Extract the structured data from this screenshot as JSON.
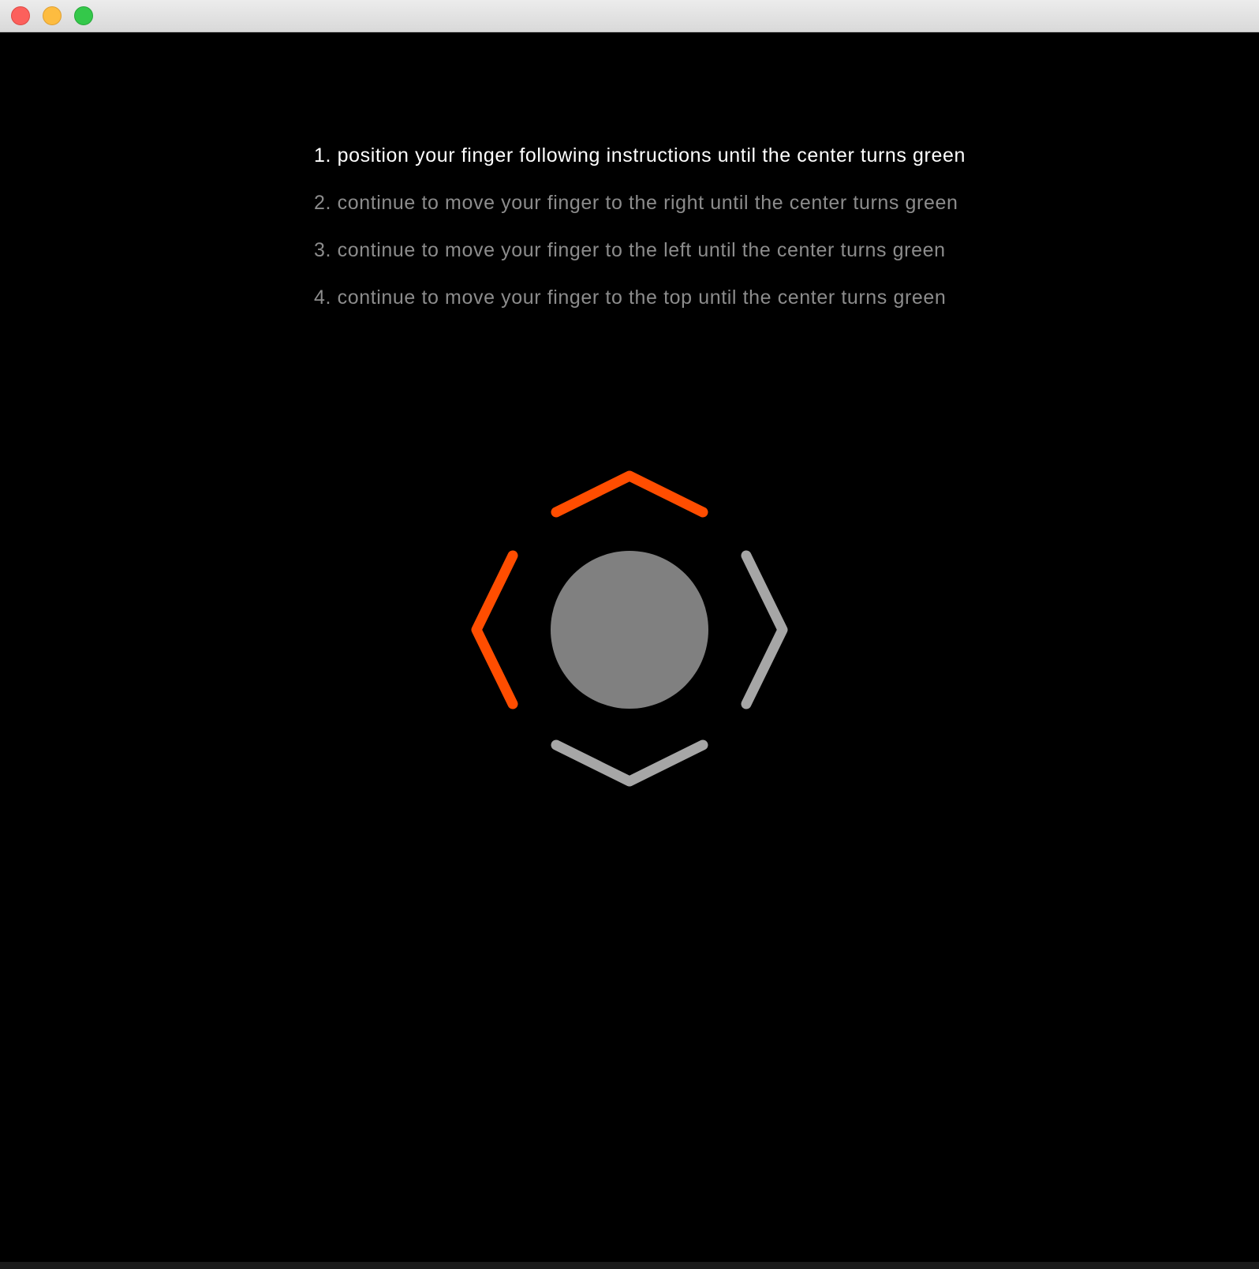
{
  "window": {
    "controls": [
      "close",
      "minimize",
      "zoom"
    ]
  },
  "instructions": [
    {
      "text": "1. position your finger following instructions until the center turns green",
      "active": true
    },
    {
      "text": "2. continue to move your finger to the right until the center turns green",
      "active": false
    },
    {
      "text": "3. continue to move your finger to the left until the center turns green",
      "active": false
    },
    {
      "text": "4. continue to move your finger to the top until the center turns green",
      "active": false
    }
  ],
  "indicator": {
    "center_color": "#808080",
    "arrows": {
      "up": {
        "icon": "chevron-up-icon",
        "color": "#ff4d00",
        "state": "active"
      },
      "left": {
        "icon": "chevron-left-icon",
        "color": "#ff4d00",
        "state": "active"
      },
      "right": {
        "icon": "chevron-right-icon",
        "color": "#a6a6a6",
        "state": "inactive"
      },
      "down": {
        "icon": "chevron-down-icon",
        "color": "#a6a6a6",
        "state": "inactive"
      }
    }
  }
}
